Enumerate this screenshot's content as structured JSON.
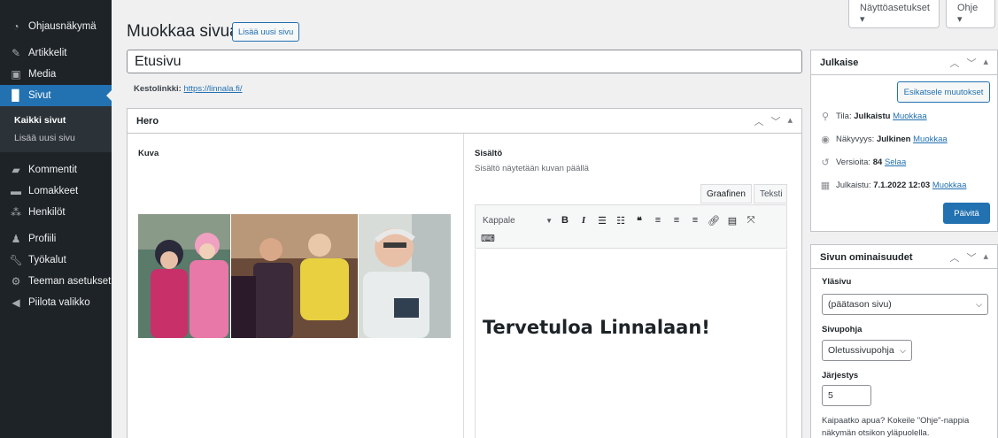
{
  "sidebar": {
    "items": [
      {
        "label": "Ohjausnäkymä",
        "icon": "dashboard-icon"
      },
      {
        "label": "Artikkelit",
        "icon": "pin-icon"
      },
      {
        "label": "Media",
        "icon": "media-icon"
      },
      {
        "label": "Sivut",
        "icon": "page-icon"
      },
      {
        "label": "Kommentit",
        "icon": "comment-icon"
      },
      {
        "label": "Lomakkeet",
        "icon": "form-icon"
      },
      {
        "label": "Henkilöt",
        "icon": "people-icon"
      },
      {
        "label": "Profiili",
        "icon": "user-icon"
      },
      {
        "label": "Työkalut",
        "icon": "wrench-icon"
      },
      {
        "label": "Teeman asetukset",
        "icon": "gear-icon"
      },
      {
        "label": "Piilota valikko",
        "icon": "collapse-icon"
      }
    ],
    "submenu": [
      "Kaikki sivut",
      "Lisää uusi sivu"
    ]
  },
  "top": {
    "screen_options": "Näyttöasetukset ▾",
    "help": "Ohje ▾"
  },
  "header": {
    "title": "Muokkaa sivua",
    "add_new": "Lisää uusi sivu"
  },
  "post": {
    "title": "Etusivu",
    "permalink_label": "Kestolinkki:",
    "permalink_url": "https://linnala.fi/"
  },
  "hero": {
    "title": "Hero",
    "image_label": "Kuva",
    "content_label": "Sisältö",
    "content_desc": "Sisältö näytetään kuvan päällä",
    "tab_visual": "Graafinen",
    "tab_text": "Teksti",
    "format_select": "Kappale",
    "editor_heading": "Tervetuloa Linnalaan!"
  },
  "publish": {
    "title": "Julkaise",
    "preview_button": "Esikatsele muutokset",
    "status_label": "Tila:",
    "status_value": "Julkaistu",
    "status_edit": "Muokkaa",
    "visibility_label": "Näkyvyys:",
    "visibility_value": "Julkinen",
    "visibility_edit": "Muokkaa",
    "revisions_label": "Versioita:",
    "revisions_value": "84",
    "revisions_browse": "Selaa",
    "published_label": "Julkaistu:",
    "published_value": "7.1.2022 12:03",
    "published_edit": "Muokkaa",
    "update_button": "Päivitä"
  },
  "attributes": {
    "title": "Sivun ominaisuudet",
    "parent_label": "Yläsivu",
    "parent_value": "(päätason sivu)",
    "template_label": "Sivupohja",
    "template_value": "Oletussivupohja",
    "order_label": "Järjestys",
    "order_value": "5",
    "help_text": "Kaipaatko apua? Kokeile \"Ohje\"-nappia näkymän otsikon yläpuolella."
  },
  "colors": {
    "accent": "#2271b1",
    "sidebar": "#1d2327",
    "background": "#f0f0f1"
  }
}
